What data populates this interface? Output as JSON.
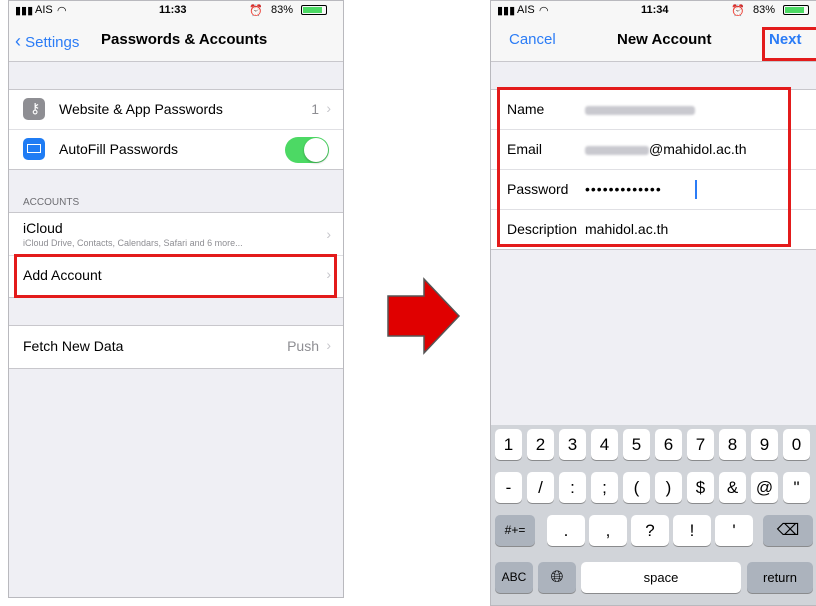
{
  "left": {
    "status": {
      "carrier": "AIS",
      "time": "11:33",
      "battery": "83%"
    },
    "nav": {
      "back_label": "Settings",
      "title": "Passwords & Accounts"
    },
    "passwords": {
      "website_label": "Website & App Passwords",
      "website_count": "1",
      "autofill_label": "AutoFill Passwords",
      "autofill_on": true
    },
    "accounts": {
      "header": "ACCOUNTS",
      "icloud_title": "iCloud",
      "icloud_subtitle": "iCloud Drive, Contacts, Calendars, Safari and 6 more...",
      "add_account": "Add Account"
    },
    "fetch": {
      "label": "Fetch New Data",
      "value": "Push"
    }
  },
  "right": {
    "status": {
      "carrier": "AIS",
      "time": "11:34",
      "battery": "83%"
    },
    "nav": {
      "cancel": "Cancel",
      "title": "New Account",
      "next": "Next"
    },
    "form": {
      "name_label": "Name",
      "email_label": "Email",
      "email_domain": "@mahidol.ac.th",
      "password_label": "Password",
      "password_value": "•••••••••••••",
      "description_label": "Description",
      "description_value": "mahidol.ac.th"
    },
    "keyboard": {
      "row1": [
        "1",
        "2",
        "3",
        "4",
        "5",
        "6",
        "7",
        "8",
        "9",
        "0"
      ],
      "row2": [
        "-",
        "/",
        ":",
        ";",
        "(",
        ")",
        "$",
        "&",
        "@",
        "\""
      ],
      "row3_left": "#+=",
      "row3_mid": [
        ".",
        ",",
        "?",
        "!",
        "'"
      ],
      "abc": "ABC",
      "space": "space",
      "return": "return"
    }
  },
  "colors": {
    "highlight": "#e31b1b",
    "ios_blue": "#2b7cf6",
    "arrow": "#e00000",
    "toggle_green": "#4cd964"
  }
}
